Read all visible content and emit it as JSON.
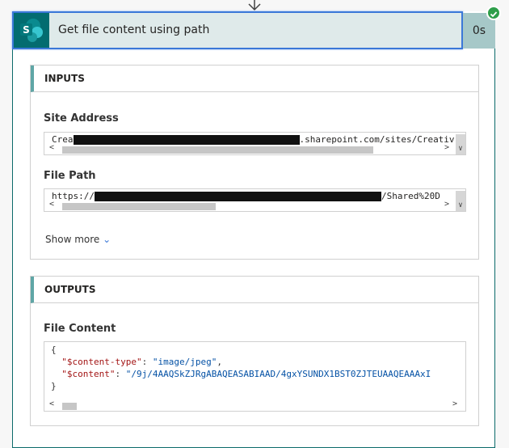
{
  "action": {
    "title": "Get file content using path",
    "duration": "0s",
    "icon": "sharepoint-icon",
    "status": "succeeded"
  },
  "inputs": {
    "header": "INPUTS",
    "site_address": {
      "label": "Site Address",
      "prefix": "Crea",
      "suffix": ".sharepoint.com/sites/Creativ"
    },
    "file_path": {
      "label": "File Path",
      "prefix": "https://",
      "suffix": "/Shared%20D"
    },
    "show_more": "Show more"
  },
  "outputs": {
    "header": "OUTPUTS",
    "file_content": {
      "label": "File Content",
      "open": "{",
      "close": "}",
      "k1": "\"$content-type\"",
      "v1": "\"image/jpeg\"",
      "k2": "\"$content\"",
      "v2": "\"/9j/4AAQSkZJRgABAQEASABIAAD/4gxYSUNDX1BST0ZJTEUAAQEAAAxI"
    }
  },
  "colors": {
    "accent": "#036c70",
    "header_bg": "#dfeaea",
    "success": "#2e9e4a",
    "selection": "#3b78d8"
  }
}
